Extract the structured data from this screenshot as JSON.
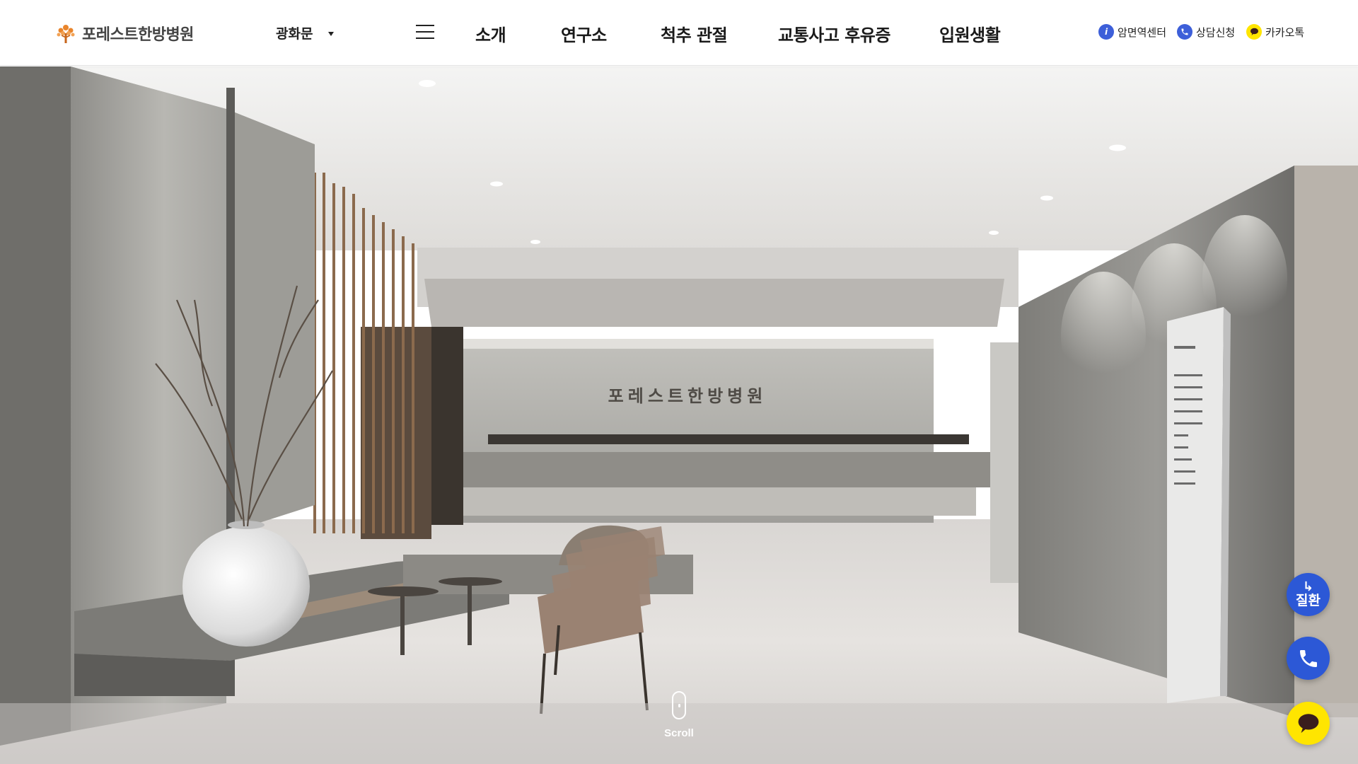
{
  "header": {
    "logo_text": "포레스트한방병원",
    "branch": "광화문",
    "nav": [
      "소개",
      "연구소",
      "척추 관절",
      "교통사고 후유증",
      "입원생활"
    ],
    "utils": [
      {
        "label": "암면역센터",
        "icon": "info-icon",
        "color": "#3d5fd9"
      },
      {
        "label": "상담신청",
        "icon": "phone-icon",
        "color": "#3d5fd9"
      },
      {
        "label": "카카오톡",
        "icon": "kakao-icon",
        "color": "#ffe500"
      }
    ]
  },
  "hero": {
    "sign_text": "포레스트한방병원"
  },
  "scroll": {
    "label": "Scroll"
  },
  "floating": {
    "disease_label": "질환",
    "disease_arrow": "↳"
  },
  "colors": {
    "accent_blue": "#2c58d6",
    "kakao_yellow": "#ffe500",
    "logo_orange": "#e9852c"
  }
}
